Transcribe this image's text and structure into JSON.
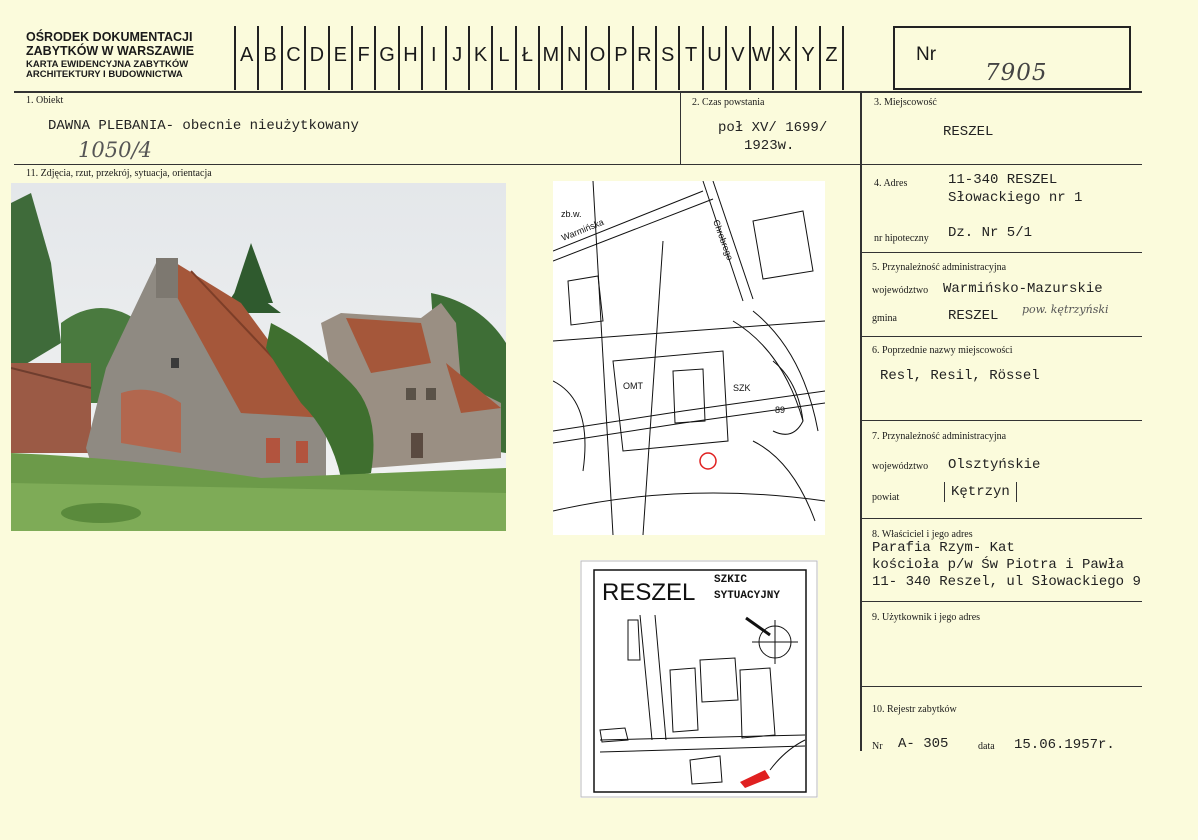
{
  "header": {
    "org_line1": "OŚRODEK DOKUMENTACJI",
    "org_line2": "ZABYTKÓW W WARSZAWIE",
    "sub_line1": "KARTA EWIDENCYJNA ZABYTKÓW",
    "sub_line2": "ARCHITEKTURY I BUDOWNICTWA",
    "letters": [
      "A",
      "B",
      "C",
      "D",
      "E",
      "F",
      "G",
      "H",
      "I",
      "J",
      "K",
      "L",
      "Ł",
      "M",
      "N",
      "O",
      "P",
      "R",
      "S",
      "T",
      "U",
      "V",
      "W",
      "X",
      "Y",
      "Z"
    ],
    "nr_label": "Nr",
    "nr_value": "7905"
  },
  "sections": {
    "obiekt": {
      "label": "1. Obiekt",
      "value": "DAWNA PLEBANIA- obecnie nieużytkowany",
      "handwritten": "1050/4"
    },
    "czas": {
      "label": "2. Czas powstania",
      "line1": "poł XV/ 1699/",
      "line2": "1923w."
    },
    "miejscowosc": {
      "label": "3. Miejscowość",
      "value": "RESZEL"
    },
    "zdjecia": {
      "label": "11. Zdjęcia, rzut, przekrój, sytuacja, orientacja"
    },
    "adres": {
      "label": "4. Adres",
      "line1": "11-340 RESZEL",
      "line2": "Słowackiego nr 1",
      "hip_label": "nr hipoteczny",
      "hip_value": "Dz. Nr 5/1"
    },
    "przynaleznosc": {
      "label": "5. Przynależność administracyjna",
      "woj_label": "województwo",
      "woj_value": "Warmińsko-Mazurskie",
      "gmina_label": "gmina",
      "gmina_value": "RESZEL",
      "pow_hand": "pow. kętrzyński"
    },
    "poprzednie": {
      "label": "6. Poprzednie nazwy miejscowości",
      "value": "Resl, Resil, Rössel"
    },
    "przynaleznosc_old": {
      "label": "7. Przynależność administracyjna",
      "woj_label": "województwo",
      "woj_value": "Olsztyńskie",
      "powiat_label": "powiat",
      "powiat_value": "Kętrzyn"
    },
    "wlasciciel": {
      "label": "8. Właściciel i jego adres",
      "line1": "Parafia Rzym- Kat",
      "line2": "kościoła p/w Św Piotra i Pawła",
      "line3": "11- 340 Reszel, ul Słowackiego 9"
    },
    "uzytkownik": {
      "label": "9. Użytkownik i jego adres"
    },
    "rejestr": {
      "label": "10. Rejestr zabytków",
      "nr_label": "Nr",
      "nr_value": "A- 305",
      "data_label": "data",
      "data_value": "15.06.1957r."
    }
  },
  "map": {
    "labels": [
      "zb.w.",
      "Warmińska",
      "Chrobrego",
      "OMT",
      "SZK",
      "89"
    ]
  },
  "sketch": {
    "city": "RESZEL",
    "title_line1": "SZKIC",
    "title_line2": "SYTUACYJNY"
  },
  "colors": {
    "paper": "#fbfbdc",
    "ink": "#1a1a1a",
    "roof": "#b35a36",
    "marker": "#e02020"
  }
}
